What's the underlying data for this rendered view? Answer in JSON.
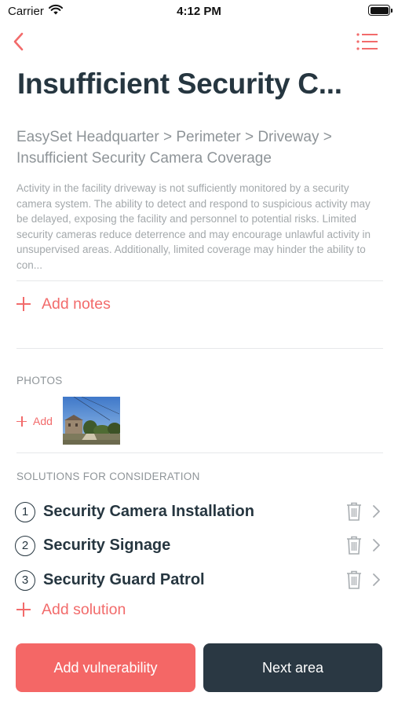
{
  "status_bar": {
    "carrier": "Carrier",
    "time": "4:12 PM",
    "battery_level": 1.0
  },
  "nav": {
    "back_icon": "chevron-left-icon",
    "menu_icon": "list-icon"
  },
  "header": {
    "title": "Insufficient Security C..."
  },
  "breadcrumb": "EasySet Headquarter > Perimeter > Driveway > Insufficient Security Camera Coverage",
  "description": "Activity in the facility driveway is not sufficiently monitored by a security camera system. The ability to detect and respond to suspicious activity may be delayed, exposing the facility and personnel to potential risks. Limited security cameras reduce deterrence and may encourage unlawful activity in unsupervised areas. Additionally, limited coverage may hinder the ability to con...",
  "notes": {
    "add_label": "Add notes"
  },
  "photos": {
    "section_label": "PHOTOS",
    "add_label": "Add"
  },
  "solutions": {
    "section_label": "SOLUTIONS FOR CONSIDERATION",
    "items": [
      {
        "number": "1",
        "name": "Security Camera Installation"
      },
      {
        "number": "2",
        "name": "Security Signage"
      },
      {
        "number": "3",
        "name": "Security Guard Patrol"
      }
    ],
    "add_label": "Add solution"
  },
  "actions": {
    "add_vulnerability": "Add vulnerability",
    "next_area": "Next area"
  },
  "colors": {
    "accent": "#f26b6b",
    "primary_button": "#f46766",
    "dark_button": "#2a3843",
    "title_text": "#263640",
    "muted_text": "#8e9498"
  }
}
